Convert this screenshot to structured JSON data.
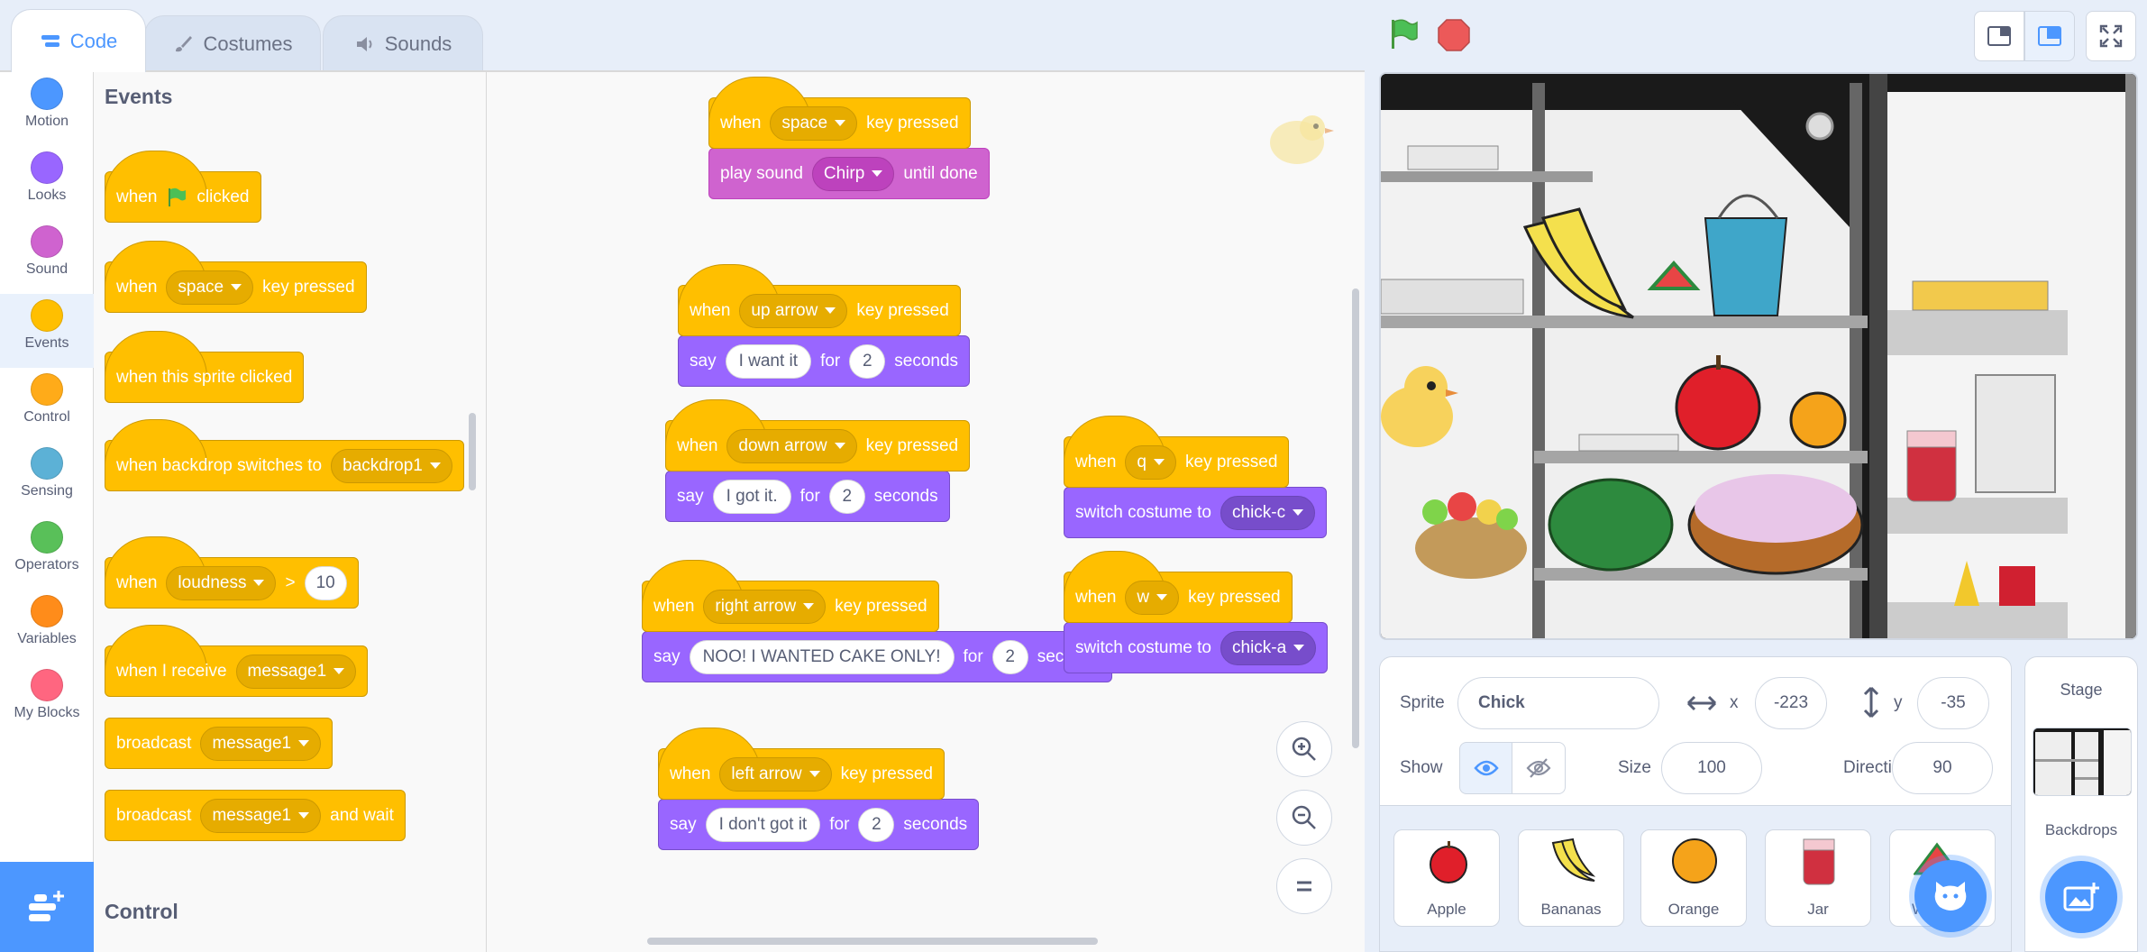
{
  "tabs": [
    {
      "label": "Code",
      "icon": "code-icon",
      "active": true
    },
    {
      "label": "Costumes",
      "icon": "brush-icon",
      "active": false
    },
    {
      "label": "Sounds",
      "icon": "speaker-icon",
      "active": false
    }
  ],
  "categories": [
    {
      "label": "Motion",
      "color": "#4c97ff"
    },
    {
      "label": "Looks",
      "color": "#9966ff"
    },
    {
      "label": "Sound",
      "color": "#cf63cf"
    },
    {
      "label": "Events",
      "color": "#ffbf00",
      "selected": true
    },
    {
      "label": "Control",
      "color": "#ffab19"
    },
    {
      "label": "Sensing",
      "color": "#5cb1d6"
    },
    {
      "label": "Operators",
      "color": "#59c059"
    },
    {
      "label": "Variables",
      "color": "#ff8c1a"
    },
    {
      "label": "My Blocks",
      "color": "#ff6680"
    }
  ],
  "palette": {
    "heading": "Events",
    "next_heading": "Control",
    "blocks": {
      "flag_clicked": {
        "when": "when",
        "clicked": "clicked"
      },
      "key_pressed": {
        "when": "when",
        "key": "space",
        "suffix": "key pressed"
      },
      "sprite_clicked": {
        "text": "when this sprite clicked"
      },
      "backdrop_switches": {
        "text": "when backdrop switches to",
        "value": "backdrop1"
      },
      "greater_than": {
        "when": "when",
        "sensor": "loudness",
        "op": ">",
        "value": "10"
      },
      "receive": {
        "text": "when I receive",
        "value": "message1"
      },
      "broadcast": {
        "text": "broadcast",
        "value": "message1"
      },
      "broadcast_wait": {
        "text": "broadcast",
        "value": "message1",
        "suffix": "and wait"
      }
    }
  },
  "scripts": {
    "s1": {
      "when": "when",
      "key": "space",
      "suffix": "key pressed",
      "action": "play sound",
      "sound": "Chirp",
      "action_suffix": "until done"
    },
    "s2": {
      "when": "when",
      "key": "up arrow",
      "suffix": "key pressed",
      "say": "say",
      "msg": "I want it",
      "for": "for",
      "secs": "2",
      "seconds": "seconds"
    },
    "s3": {
      "when": "when",
      "key": "down arrow",
      "suffix": "key pressed",
      "say": "say",
      "msg": "I got it.",
      "for": "for",
      "secs": "2",
      "seconds": "seconds"
    },
    "s4": {
      "when": "when",
      "key": "right arrow",
      "suffix": "key pressed",
      "say": "say",
      "msg": "NOO! I WANTED CAKE ONLY!",
      "for": "for",
      "secs": "2",
      "seconds": "seconds"
    },
    "s5": {
      "when": "when",
      "key": "left arrow",
      "suffix": "key pressed",
      "say": "say",
      "msg": "I don't got it",
      "for": "for",
      "secs": "2",
      "seconds": "seconds"
    },
    "s6": {
      "when": "when",
      "key": "q",
      "suffix": "key pressed",
      "action": "switch costume to",
      "costume": "chick-c"
    },
    "s7": {
      "when": "when",
      "key": "w",
      "suffix": "key pressed",
      "action": "switch costume to",
      "costume": "chick-a"
    }
  },
  "zoom_controls": [
    "zoom-in-icon",
    "zoom-out-icon",
    "zoom-reset-icon"
  ],
  "header": {
    "green_flag": "green-flag-icon",
    "stop": "stop-icon",
    "layout_buttons": [
      "small-stage-icon",
      "normal-stage-icon",
      "fullscreen-icon"
    ]
  },
  "sprite_info": {
    "sprite_label": "Sprite",
    "sprite_name": "Chick",
    "x_label": "x",
    "x_value": "-223",
    "y_label": "y",
    "y_value": "-35",
    "show_label": "Show",
    "size_label": "Size",
    "size_value": "100",
    "direction_label": "Direction",
    "direction_value": "90"
  },
  "sprites": [
    "Apple",
    "Bananas",
    "Orange",
    "Jar",
    "Wa"
  ],
  "stage_panel": {
    "title": "Stage",
    "backdrops_label": "Backdrops"
  }
}
